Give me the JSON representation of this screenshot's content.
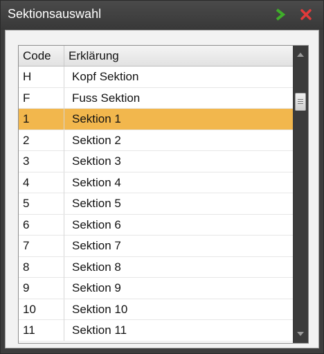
{
  "window": {
    "title": "Sektionsauswahl"
  },
  "toolbar": {
    "ok_icon": "chevron-right-icon",
    "close_icon": "close-x-icon"
  },
  "table": {
    "headers": {
      "code": "Code",
      "description": "Erklärung"
    },
    "selected_index": 2,
    "rows": [
      {
        "code": "H",
        "description": "Kopf Sektion"
      },
      {
        "code": "F",
        "description": "Fuss Sektion"
      },
      {
        "code": "1",
        "description": "Sektion 1"
      },
      {
        "code": "2",
        "description": "Sektion 2"
      },
      {
        "code": "3",
        "description": "Sektion 3"
      },
      {
        "code": "4",
        "description": "Sektion 4"
      },
      {
        "code": "5",
        "description": "Sektion 5"
      },
      {
        "code": "6",
        "description": "Sektion 6"
      },
      {
        "code": "7",
        "description": "Sektion 7"
      },
      {
        "code": "8",
        "description": "Sektion 8"
      },
      {
        "code": "9",
        "description": "Sektion 9"
      },
      {
        "code": "10",
        "description": "Sektion 10"
      },
      {
        "code": "11",
        "description": "Sektion 11"
      }
    ]
  },
  "colors": {
    "selection": "#f2b74d",
    "titlebar": "#3d3d3d",
    "ok_icon": "#3fae2a",
    "close_icon": "#e23a3a"
  }
}
